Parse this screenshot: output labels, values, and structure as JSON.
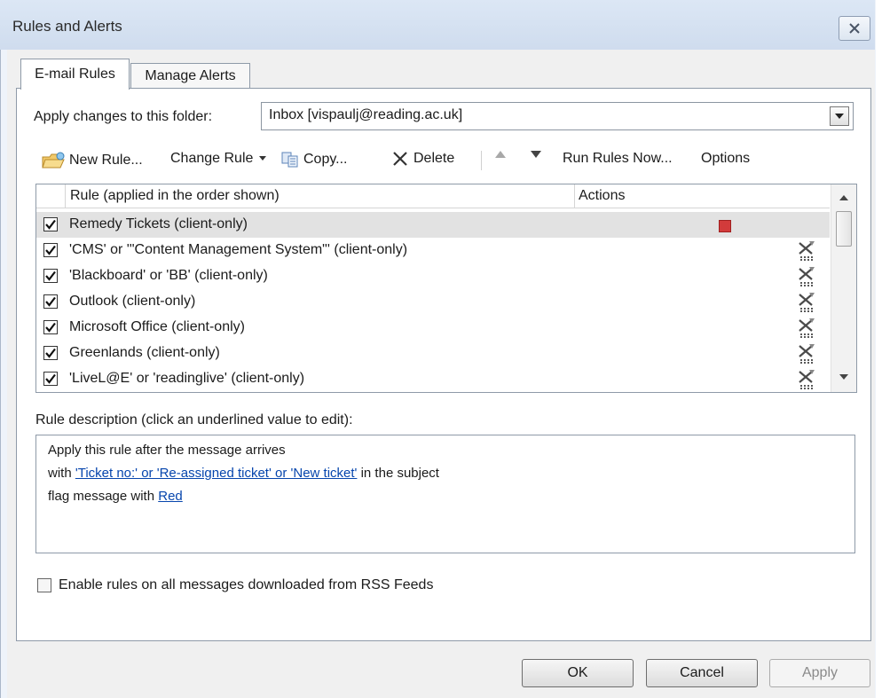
{
  "window": {
    "title": "Rules and Alerts"
  },
  "tabs": [
    {
      "label": "E-mail Rules",
      "active": true
    },
    {
      "label": "Manage Alerts",
      "active": false
    }
  ],
  "folder": {
    "label": "Apply changes to this folder:",
    "value": "Inbox [vispaulj@reading.ac.uk]"
  },
  "toolbar": {
    "new_rule": "New Rule...",
    "change_rule": "Change Rule",
    "copy": "Copy...",
    "delete": "Delete",
    "run_rules_now": "Run Rules Now...",
    "options": "Options"
  },
  "rules_list": {
    "columns": [
      "Rule (applied in the order shown)",
      "Actions"
    ],
    "rows": [
      {
        "name": "Remedy Tickets  (client-only)",
        "checked": true,
        "selected": true,
        "action_icon": "flag-red-icon"
      },
      {
        "name": "'CMS' or '\"Content Management System\"'  (client-only)",
        "checked": true,
        "action_icon": "move-to-folder-icon"
      },
      {
        "name": "'Blackboard' or 'BB'  (client-only)",
        "checked": true,
        "action_icon": "move-to-folder-icon"
      },
      {
        "name": "Outlook  (client-only)",
        "checked": true,
        "action_icon": "move-to-folder-icon"
      },
      {
        "name": "Microsoft Office  (client-only)",
        "checked": true,
        "action_icon": "move-to-folder-icon"
      },
      {
        "name": "Greenlands  (client-only)",
        "checked": true,
        "action_icon": "move-to-folder-icon"
      },
      {
        "name": "'LiveL@E' or 'readinglive'  (client-only)",
        "checked": true,
        "action_icon": "move-to-folder-icon"
      }
    ]
  },
  "description": {
    "label": "Rule description (click an underlined value to edit):",
    "line1": "Apply this rule after the message arrives",
    "line2_prefix": "with ",
    "line2_link": "'Ticket no:' or 'Re-assigned ticket' or 'New ticket'",
    "line2_suffix": " in the subject",
    "line3_prefix": "flag message with ",
    "line3_link": "Red"
  },
  "rss": {
    "label": "Enable rules on all messages downloaded from RSS Feeds",
    "checked": false
  },
  "buttons": {
    "ok": "OK",
    "cancel": "Cancel",
    "apply": "Apply"
  },
  "colors": {
    "flag": "#d23b3b",
    "link": "#0645ad",
    "selected_row": "#e2e2e2"
  }
}
